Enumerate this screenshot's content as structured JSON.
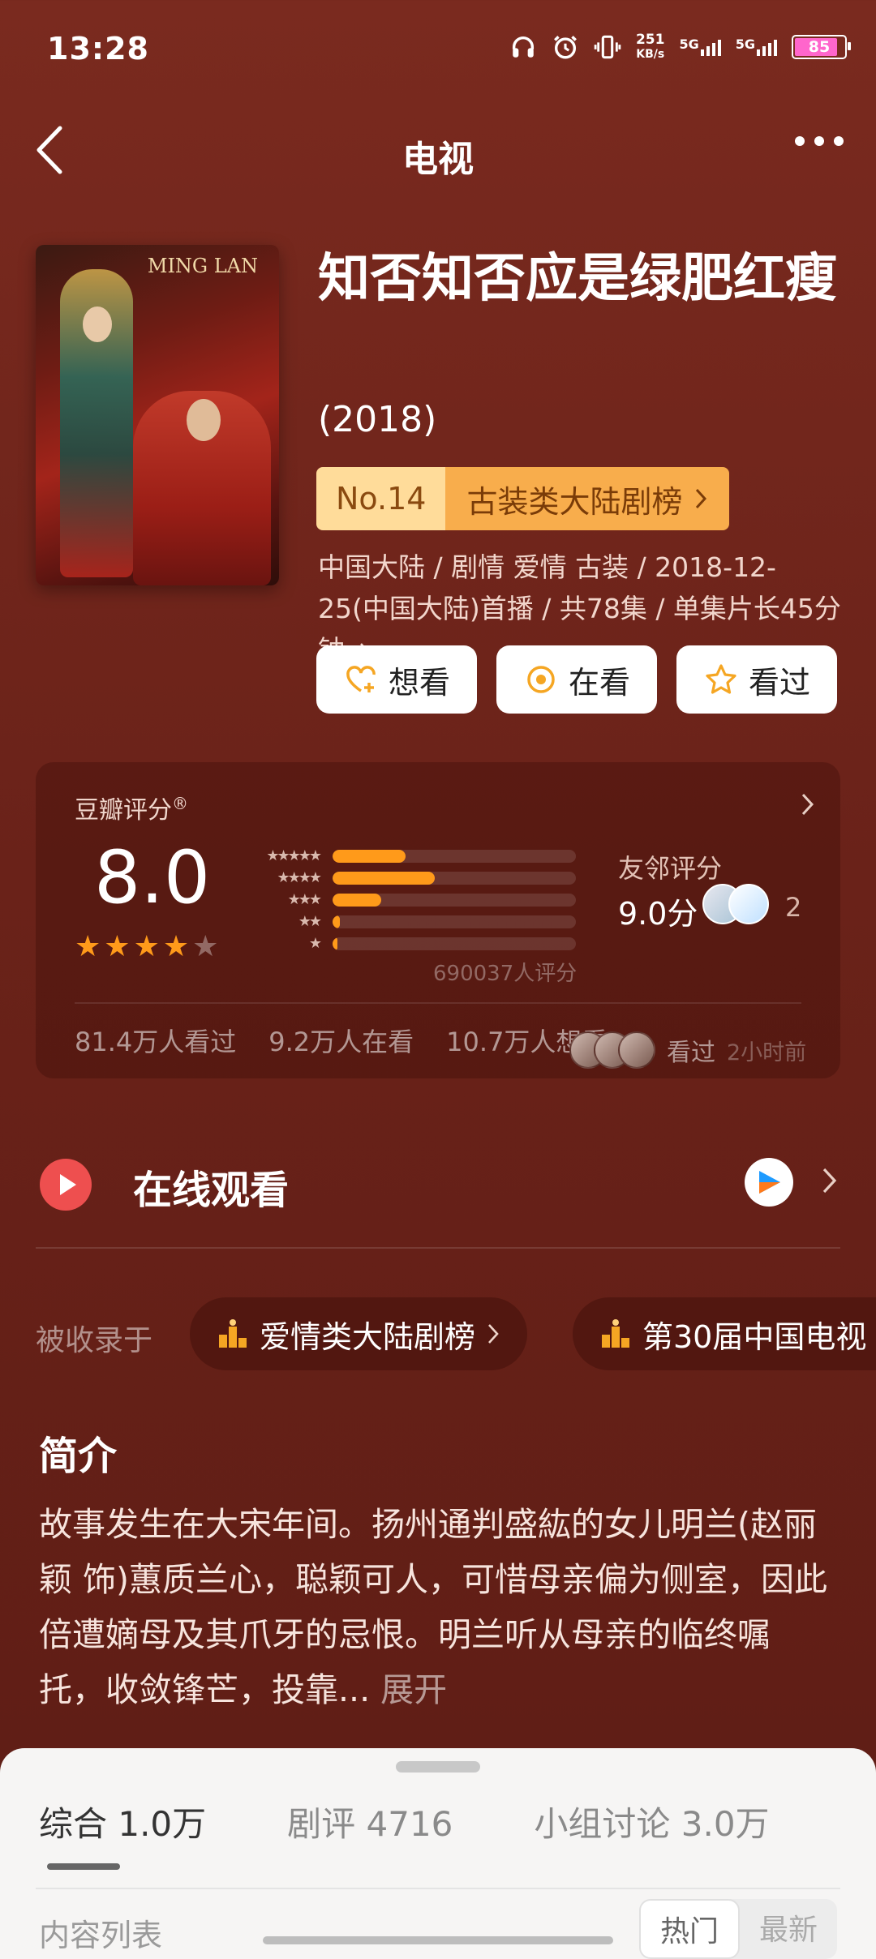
{
  "status_bar": {
    "time": "13:28",
    "speed_value": "251",
    "speed_unit": "KB/s",
    "net1": "5G",
    "net2": "5G",
    "battery": "85",
    "icons": [
      "headphones-icon",
      "alarm-icon",
      "vibrate-icon"
    ]
  },
  "nav": {
    "title": "电视"
  },
  "movie": {
    "poster_text": "MING LAN",
    "title": "知否知否应是绿肥红瘦",
    "year": "(2018)",
    "rank_no": "No.14",
    "rank_category": "古装类大陆剧榜",
    "meta": "中国大陆 / 剧情 爱情 古装 / 2018-12-25(中国大陆)首播 / 共78集 / 单集片长45分钟"
  },
  "actions": [
    {
      "label": "想看",
      "icon": "heart-plus-icon"
    },
    {
      "label": "在看",
      "icon": "target-icon"
    },
    {
      "label": "看过",
      "icon": "star-icon"
    }
  ],
  "rating": {
    "label": "豆瓣评分",
    "score": "8.0",
    "stars": 4,
    "distribution": [
      0.3,
      0.42,
      0.2,
      0.03,
      0.02
    ],
    "star_labels": [
      "★★★★★",
      "★★★★",
      "★★★",
      "★★",
      "★"
    ],
    "count_text": "690037人评分",
    "neighbor_label": "友邻评分",
    "neighbor_score": "9.0分",
    "neighbor_count": "2",
    "stats": [
      "81.4万人看过",
      "9.2万人在看",
      "10.7万人想看"
    ],
    "recent_text": "看过",
    "recent_time": "2小时前"
  },
  "watch": {
    "label": "在线观看"
  },
  "collections": {
    "label": "被收录于",
    "items": [
      "爱情类大陆剧榜",
      "第30届中国电视"
    ]
  },
  "intro": {
    "heading": "简介",
    "text": "故事发生在大宋年间。扬州通判盛紘的女儿明兰(赵丽颖 饰)蕙质兰心，聪颖可人，可惜母亲偏为侧室，因此倍遭嫡母及其爪牙的忌恨。明兰听从母亲的临终嘱托，收敛锋芒，投靠... ",
    "more": "展开"
  },
  "bottom_sheet": {
    "tabs": [
      "综合 1.0万",
      "剧评 4716",
      "小组讨论 3.0万"
    ],
    "list_label": "内容列表",
    "sort_options": [
      "热门",
      "最新"
    ]
  },
  "colors": {
    "accent": "#ff9a1a",
    "bg": "#6a2219",
    "rank_light": "#ffdc9a",
    "rank_dark": "#f8ad4c"
  }
}
